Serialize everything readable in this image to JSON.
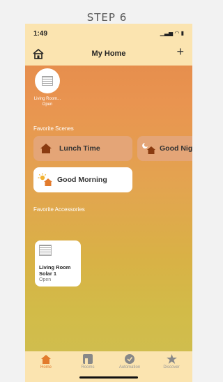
{
  "step_label": "STEP 6",
  "status": {
    "time": "1:49",
    "icons": "▁▃▅ ◠ ▮"
  },
  "header": {
    "title": "My Home",
    "add_symbol": "+"
  },
  "top_accessory": {
    "label": "Living Room...",
    "state": "Open"
  },
  "favorite_scenes": {
    "title": "Favorite Scenes",
    "items": [
      {
        "label": "Lunch Time",
        "icon": "house-icon"
      },
      {
        "label": "Good Nig",
        "icon": "moon-house-icon"
      },
      {
        "label": "Good Morning",
        "icon": "sun-house-icon"
      }
    ]
  },
  "favorite_accessories": {
    "title": "Favorite Accessories",
    "items": [
      {
        "name_line1": "Living Room",
        "name_line2": "Solar 1",
        "state": "Open"
      }
    ]
  },
  "tabs": [
    {
      "label": "Home",
      "active": true
    },
    {
      "label": "Rooms",
      "active": false
    },
    {
      "label": "Automation",
      "active": false
    },
    {
      "label": "Discover",
      "active": false
    }
  ],
  "colors": {
    "accent": "#e27b2d",
    "header_bg": "#fbe4b0"
  }
}
